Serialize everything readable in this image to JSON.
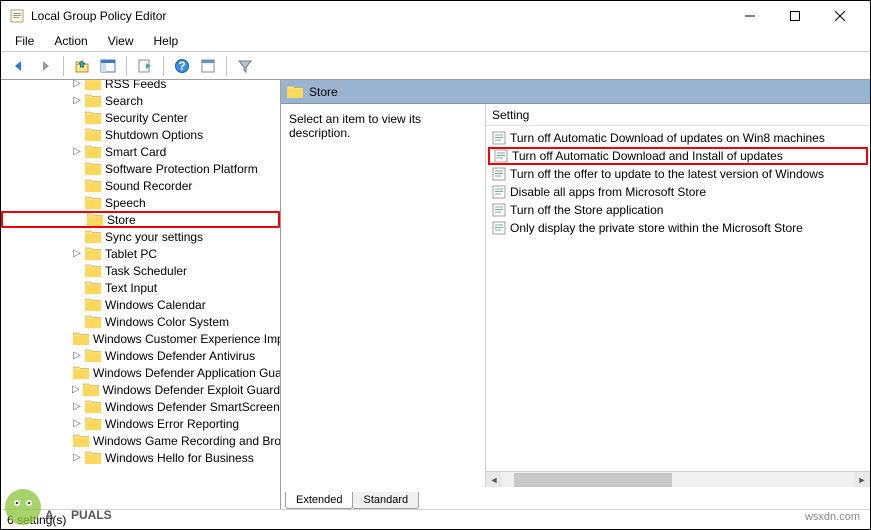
{
  "window": {
    "title": "Local Group Policy Editor"
  },
  "menu": {
    "file": "File",
    "action": "Action",
    "view": "View",
    "help": "Help"
  },
  "tree": {
    "items": [
      {
        "label": "RSS Feeds",
        "expander": "▷"
      },
      {
        "label": "Search",
        "expander": "▷"
      },
      {
        "label": "Security Center",
        "expander": ""
      },
      {
        "label": "Shutdown Options",
        "expander": ""
      },
      {
        "label": "Smart Card",
        "expander": "▷"
      },
      {
        "label": "Software Protection Platform",
        "expander": ""
      },
      {
        "label": "Sound Recorder",
        "expander": ""
      },
      {
        "label": "Speech",
        "expander": ""
      },
      {
        "label": "Store",
        "expander": "",
        "selected": true,
        "highlight": true
      },
      {
        "label": "Sync your settings",
        "expander": ""
      },
      {
        "label": "Tablet PC",
        "expander": "▷"
      },
      {
        "label": "Task Scheduler",
        "expander": ""
      },
      {
        "label": "Text Input",
        "expander": ""
      },
      {
        "label": "Windows Calendar",
        "expander": ""
      },
      {
        "label": "Windows Color System",
        "expander": ""
      },
      {
        "label": "Windows Customer Experience Improvement Program",
        "expander": ""
      },
      {
        "label": "Windows Defender Antivirus",
        "expander": "▷"
      },
      {
        "label": "Windows Defender Application Guard",
        "expander": ""
      },
      {
        "label": "Windows Defender Exploit Guard",
        "expander": "▷"
      },
      {
        "label": "Windows Defender SmartScreen",
        "expander": "▷"
      },
      {
        "label": "Windows Error Reporting",
        "expander": "▷"
      },
      {
        "label": "Windows Game Recording and Broadcasting",
        "expander": ""
      },
      {
        "label": "Windows Hello for Business",
        "expander": "▷"
      }
    ]
  },
  "details": {
    "header": "Store",
    "description": "Select an item to view its description.",
    "column_header": "Setting",
    "settings": [
      {
        "label": "Turn off Automatic Download of updates on Win8 machines"
      },
      {
        "label": "Turn off Automatic Download and Install of updates",
        "highlight": true
      },
      {
        "label": "Turn off the offer to update to the latest version of Windows"
      },
      {
        "label": "Disable all apps from Microsoft Store"
      },
      {
        "label": "Turn off the Store application"
      },
      {
        "label": "Only display the private store within the Microsoft Store"
      }
    ],
    "tabs": {
      "extended": "Extended",
      "standard": "Standard"
    }
  },
  "status": {
    "text": "6 setting(s)"
  },
  "watermark": {
    "site": "wsxdn.com",
    "brand": "A  PUALS"
  }
}
